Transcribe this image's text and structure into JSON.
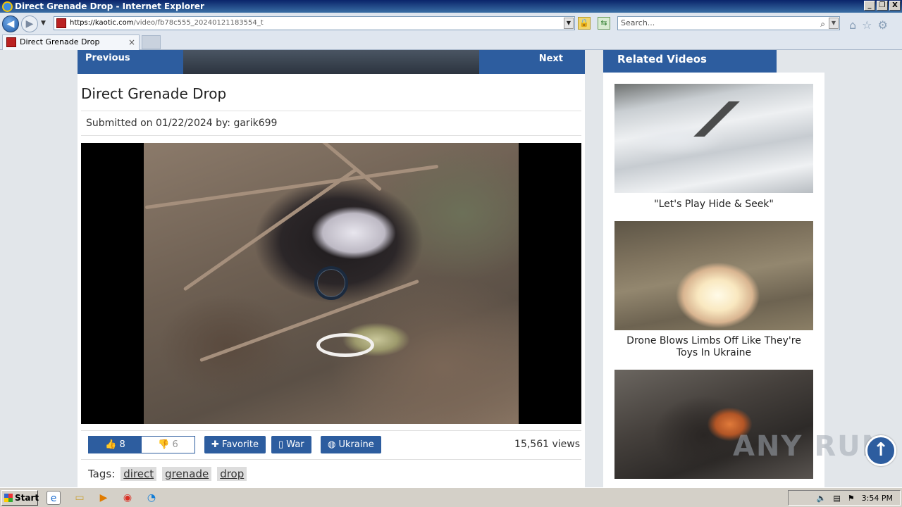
{
  "window": {
    "title": "Direct Grenade Drop - Internet Explorer",
    "minimize": "_",
    "restore": "❐",
    "close": "X"
  },
  "browser": {
    "url_host": "https://kaotic.com",
    "url_path": "/video/fb78c555_20240121183554_t",
    "search_placeholder": "Search...",
    "tab_title": "Direct Grenade Drop",
    "tab_close": "×"
  },
  "page": {
    "prev_label": "Previous",
    "next_label": "Next",
    "title": "Direct Grenade Drop",
    "submitted_prefix": "Submitted on 01/22/2024 by:",
    "submitted_by": "garik699",
    "likes": "8",
    "dislikes": "6",
    "favorite_label": "Favorite",
    "category_label": "War",
    "region_label": "Ukraine",
    "views": "15,561 views",
    "tags_label": "Tags:",
    "tags": [
      "direct",
      "grenade",
      "drop"
    ]
  },
  "sidebar": {
    "heading": "Related Videos",
    "items": [
      {
        "caption": "\"Let's Play Hide & Seek\""
      },
      {
        "caption": "Drone Blows Limbs Off Like They're Toys In Ukraine"
      },
      {
        "caption": ""
      }
    ]
  },
  "overlay": {
    "watermark": "ANY RUN"
  },
  "taskbar": {
    "start_label": "Start",
    "clock": "3:54 PM"
  },
  "colors": {
    "accent": "#2d5d9f",
    "titlebar": "#0a246a"
  }
}
